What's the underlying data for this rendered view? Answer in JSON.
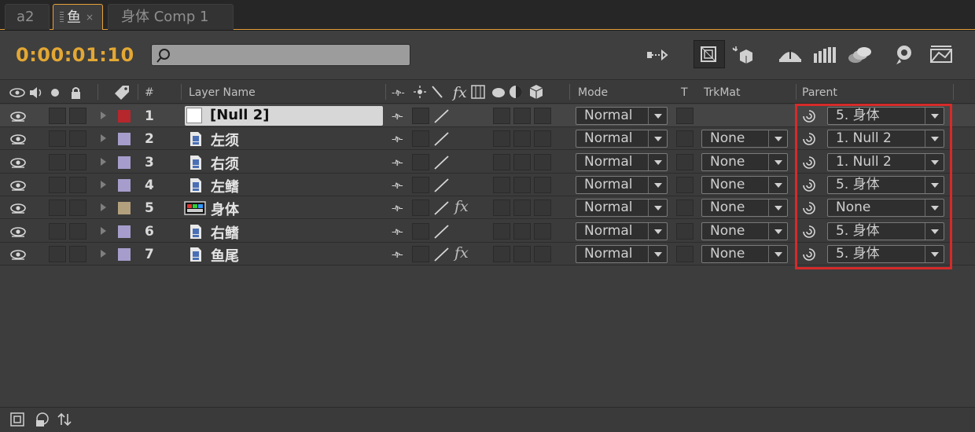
{
  "tabs": [
    {
      "label": "a2",
      "active": false
    },
    {
      "label": "鱼",
      "active": true,
      "close": "×"
    },
    {
      "label": "身体 Comp 1",
      "active": false
    }
  ],
  "timecode": "0:00:01:10",
  "search": {
    "placeholder": ""
  },
  "toolbar_icons": [
    "composition-flowchart-icon",
    "draft-3d-icon",
    "hide-shy-layers-icon",
    "frame-blending-icon",
    "motion-blur-icon",
    "brainstorm-icon",
    "graph-editor-icon"
  ],
  "columns": {
    "layer_name": "Layer Name",
    "number": "#",
    "mode": "Mode",
    "t": "T",
    "trkmat": "TrkMat",
    "parent": "Parent"
  },
  "switch_symbols": {
    "shy": "-ቅ-",
    "fx": "fx"
  },
  "layers": [
    {
      "number": "1",
      "name": "[Null 2]",
      "label_color": "#b5272d",
      "type": "null",
      "mode": "Normal",
      "trkmat": "",
      "parent": "5. 身体",
      "fx": false,
      "selected": true
    },
    {
      "number": "2",
      "name": "左须",
      "label_color": "#a69dcc",
      "type": "footage",
      "mode": "Normal",
      "trkmat": "None",
      "parent": "1. Null 2",
      "fx": false,
      "selected": false
    },
    {
      "number": "3",
      "name": "右须",
      "label_color": "#a69dcc",
      "type": "footage",
      "mode": "Normal",
      "trkmat": "None",
      "parent": "1. Null 2",
      "fx": false,
      "selected": false
    },
    {
      "number": "4",
      "name": "左鳍",
      "label_color": "#a69dcc",
      "type": "footage",
      "mode": "Normal",
      "trkmat": "None",
      "parent": "5. 身体",
      "fx": false,
      "selected": false
    },
    {
      "number": "5",
      "name": "身体",
      "label_color": "#b3a07c",
      "type": "composition",
      "mode": "Normal",
      "trkmat": "None",
      "parent": "None",
      "fx": true,
      "selected": false
    },
    {
      "number": "6",
      "name": "右鳍",
      "label_color": "#a69dcc",
      "type": "footage",
      "mode": "Normal",
      "trkmat": "None",
      "parent": "5. 身体",
      "fx": false,
      "selected": false
    },
    {
      "number": "7",
      "name": "鱼尾",
      "label_color": "#a69dcc",
      "type": "footage",
      "mode": "Normal",
      "trkmat": "None",
      "parent": "5. 身体",
      "fx": true,
      "selected": false
    }
  ],
  "highlight_color": "#d52a2a",
  "accent_color": "#e3a733"
}
